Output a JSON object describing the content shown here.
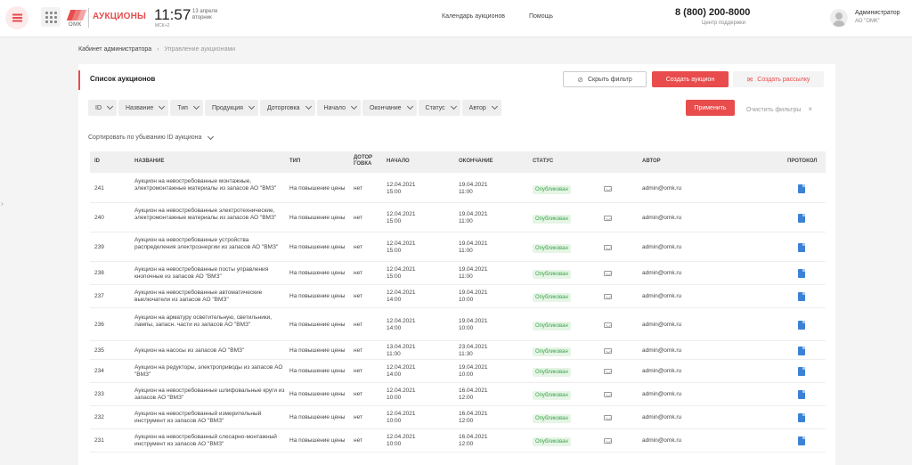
{
  "header": {
    "logo_omk": "ОМК",
    "title": "АУКЦИОНЫ",
    "time": "11:57",
    "date_line1": "13 апреля",
    "date_line2": "вторник",
    "timezone": "МСК+2",
    "links": [
      "Календарь аукционов",
      "Помощь"
    ],
    "phone": "8 (800) 200-8000",
    "phone_caption": "Центр поддержки",
    "user_name": "Администратор",
    "user_org": "АО \"ОМК\""
  },
  "breadcrumb": {
    "root": "Кабинет администратора",
    "separator": "›",
    "current": "Управление аукционами"
  },
  "card": {
    "title": "Список аукционов",
    "hide_filter": "Скрыть фильтр",
    "create_auction": "Создать аукцион",
    "create_mailing": "Создать рассылку",
    "apply": "Применить",
    "clear": "Очистить фильтры",
    "clear_x": "×",
    "sort_label": "Сортировать",
    "sort_value": "по убыванию ID аукциона"
  },
  "filters": [
    "ID",
    "Название",
    "Тип",
    "Продукция",
    "Доторговка",
    "Начало",
    "Окончание",
    "Статус",
    "Автор"
  ],
  "table": {
    "headers": {
      "id": "ID",
      "name": "НАЗВАНИЕ",
      "type": "ТИП",
      "dot1": "ДОТОР",
      "dot2": "ГОВКА",
      "start": "НАЧАЛО",
      "end": "ОКОНЧАНИЕ",
      "status": "СТАТУС",
      "author": "АВТОР",
      "protocol": "ПРОТОКОЛ"
    },
    "rows": [
      {
        "id": "241",
        "name": "Аукцион на невостребованные монтажные, электромонтажные материалы из запасов АО \"ВМЗ\"",
        "type": "На повышение цены",
        "dot": "нет",
        "start_d": "12.04.2021",
        "start_t": "15:00",
        "end_d": "19.04.2021",
        "end_t": "11:00",
        "status": "Опубликован",
        "author": "admin@omk.ru"
      },
      {
        "id": "240",
        "name": "Аукцион на невостребованные электротехнические, электромонтажные материалы из запасов АО \"ВМЗ\"",
        "type": "На повышение цены",
        "dot": "нет",
        "start_d": "12.04.2021",
        "start_t": "15:00",
        "end_d": "19.04.2021",
        "end_t": "11:00",
        "status": "Опубликован",
        "author": "admin@omk.ru"
      },
      {
        "id": "239",
        "name": "Аукцион на невостребованные устройства распределения электроэнергии из запасов АО \"ВМЗ\"",
        "type": "На повышение цены",
        "dot": "нет",
        "start_d": "12.04.2021",
        "start_t": "15:00",
        "end_d": "19.04.2021",
        "end_t": "11:00",
        "status": "Опубликован",
        "author": "admin@omk.ru"
      },
      {
        "id": "238",
        "name": "Аукцион на невостребованные посты управления кнопочные из запасов АО \"ВМЗ\"",
        "type": "На повышение цены",
        "dot": "нет",
        "start_d": "12.04.2021",
        "start_t": "15:00",
        "end_d": "19.04.2021",
        "end_t": "11:00",
        "status": "Опубликован",
        "author": "admin@omk.ru"
      },
      {
        "id": "237",
        "name": "Аукцион на невостребованные автоматические выключатели из запасов АО \"ВМЗ\"",
        "type": "На повышение цены",
        "dot": "нет",
        "start_d": "12.04.2021",
        "start_t": "14:00",
        "end_d": "19.04.2021",
        "end_t": "10:00",
        "status": "Опубликован",
        "author": "admin@omk.ru"
      },
      {
        "id": "236",
        "name": "Аукцион на арматуру осветительную, светильники, лампы, запасн. части из запасов АО \"ВМЗ\"",
        "type": "На повышение цены",
        "dot": "нет",
        "start_d": "12.04.2021",
        "start_t": "14:00",
        "end_d": "19.04.2021",
        "end_t": "10:00",
        "status": "Опубликован",
        "author": "admin@omk.ru"
      },
      {
        "id": "235",
        "name": "Аукцион на насосы из запасов АО \"ВМЗ\"",
        "type": "На повышение цены",
        "dot": "нет",
        "start_d": "13.04.2021",
        "start_t": "11:00",
        "end_d": "23.04.2021",
        "end_t": "11:30",
        "status": "Опубликован",
        "author": "admin@omk.ru"
      },
      {
        "id": "234",
        "name": "Аукцион на редукторы, электроприводы из запасов АО \"ВМЗ\"",
        "type": "На повышение цены",
        "dot": "нет",
        "start_d": "12.04.2021",
        "start_t": "14:00",
        "end_d": "19.04.2021",
        "end_t": "10:00",
        "status": "Опубликован",
        "author": "admin@omk.ru"
      },
      {
        "id": "233",
        "name": "Аукцион на невостребованные шлифовальные круги из запасов АО \"ВМЗ\"",
        "type": "На повышение цены",
        "dot": "нет",
        "start_d": "12.04.2021",
        "start_t": "10:00",
        "end_d": "16.04.2021",
        "end_t": "12:00",
        "status": "Опубликован",
        "author": "admin@omk.ru"
      },
      {
        "id": "232",
        "name": "Аукцион на невостребованный измерительный инструмент из запасов АО \"ВМЗ\"",
        "type": "На повышение цены",
        "dot": "нет",
        "start_d": "12.04.2021",
        "start_t": "10:00",
        "end_d": "16.04.2021",
        "end_t": "12:00",
        "status": "Опубликован",
        "author": "admin@omk.ru"
      },
      {
        "id": "231",
        "name": "Аукцион на невостребованный слесарно-монтажный инструмент из запасов АО \"ВМЗ\"",
        "type": "На повышение цены",
        "dot": "нет",
        "start_d": "12.04.2021",
        "start_t": "10:00",
        "end_d": "16.04.2021",
        "end_t": "12:00",
        "status": "Опубликован",
        "author": "admin@omk.ru"
      }
    ]
  },
  "icons": {
    "menu": "hamburger-icon",
    "apps": "grid-icon",
    "filter": "filter-off-icon",
    "mail": "envelope-icon",
    "protocol": "document-icon",
    "avatar": "user-icon"
  },
  "colors": {
    "accent": "#e84c4c",
    "status_green": "#3aa64a",
    "status_bg": "#e6f5e6",
    "protocol_blue": "#3b82d6"
  }
}
